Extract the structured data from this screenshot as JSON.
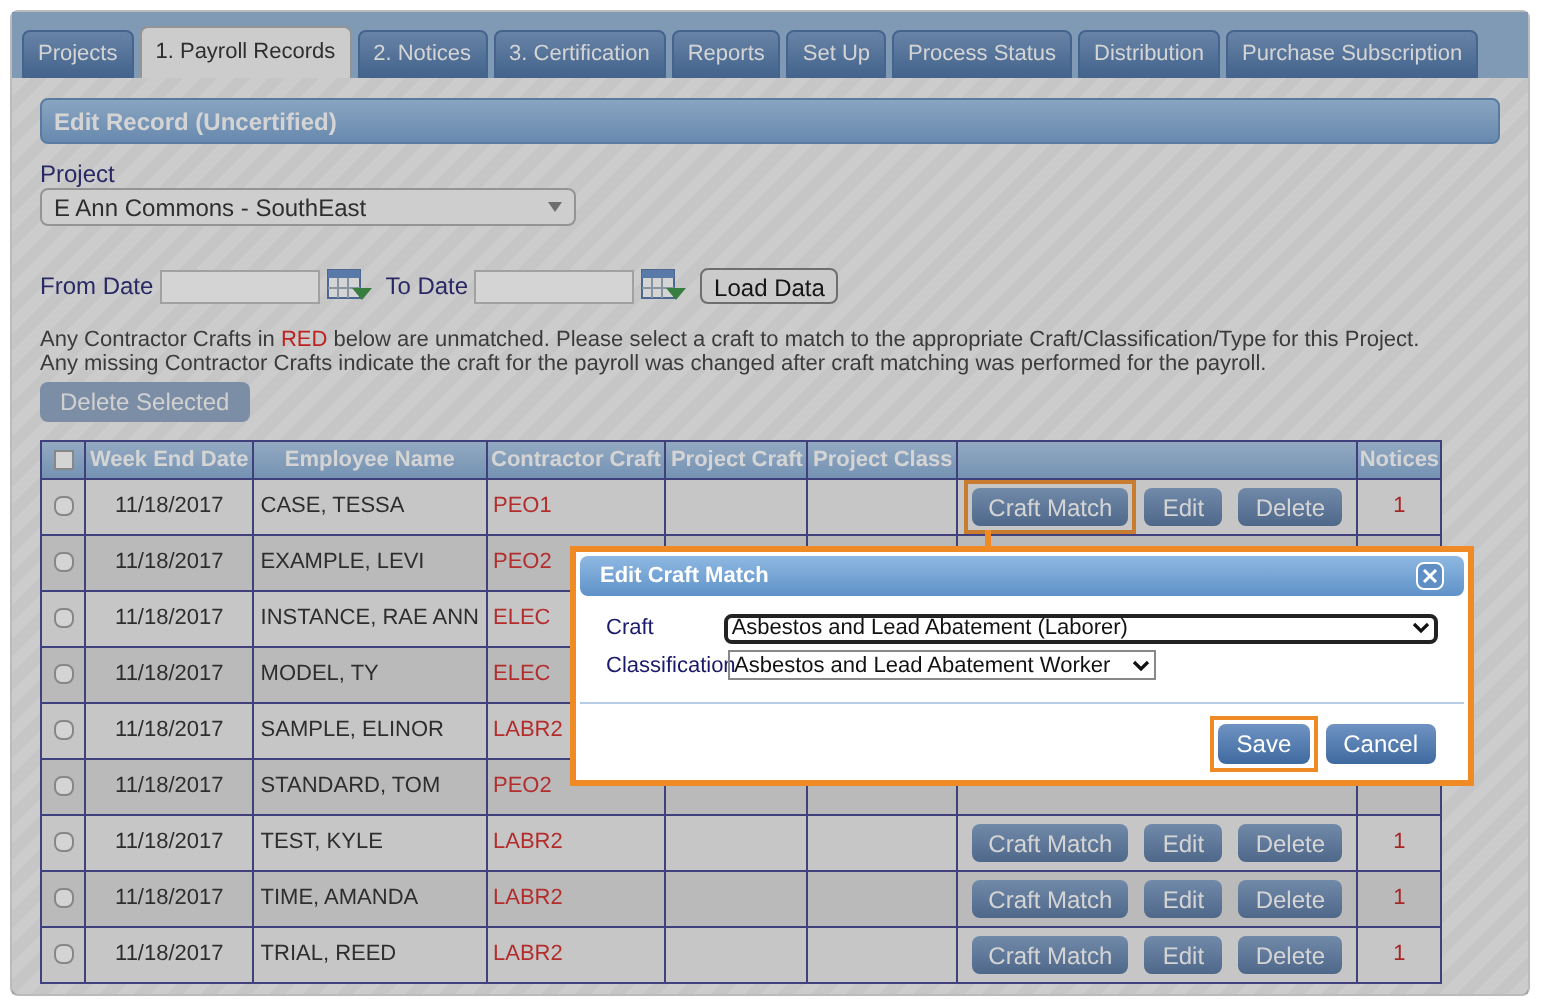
{
  "tabs": [
    {
      "label": "Projects",
      "selected": false
    },
    {
      "label": "1. Payroll Records",
      "selected": true
    },
    {
      "label": "2. Notices",
      "selected": false
    },
    {
      "label": "3. Certification",
      "selected": false
    },
    {
      "label": "Reports",
      "selected": false
    },
    {
      "label": "Set Up",
      "selected": false
    },
    {
      "label": "Process Status",
      "selected": false
    },
    {
      "label": "Distribution",
      "selected": false
    },
    {
      "label": "Purchase Subscription",
      "selected": false
    }
  ],
  "section_title": "Edit Record (Uncertified)",
  "project": {
    "label": "Project",
    "value": "E Ann Commons - SouthEast"
  },
  "from_date": {
    "label": "From Date"
  },
  "to_date": {
    "label": "To Date"
  },
  "load_button": "Load Data",
  "notes": [
    {
      "before": "Any Contractor Crafts in ",
      "highlight": "RED",
      "after": " below are unmatched. Please select a craft to match to the appropriate Craft/Classification/Type for this Project."
    },
    {
      "before": "Any missing Contractor Crafts indicate the craft for the payroll was changed after craft matching was performed for the payroll."
    }
  ],
  "delete_button": {
    "label": "Delete Selected",
    "disabled": true
  },
  "table": {
    "select_all": {
      "checked": false
    },
    "columns": [
      "Week End Date",
      "Employee Name",
      "Contractor Craft",
      "Project Craft",
      "Project Class",
      "Notices"
    ],
    "rows": [
      {
        "selected": false,
        "date": "11/18/2017",
        "employee": "CASE, TESSA",
        "craft": "PEO1",
        "unmatched": true,
        "actions": [
          {
            "label": "Craft Match",
            "highlighted": true
          },
          {
            "label": "Edit",
            "highlighted": false
          },
          {
            "label": "Delete",
            "highlighted": false
          }
        ],
        "notices": "1"
      },
      {
        "selected": false,
        "date": "11/18/2017",
        "employee": "EXAMPLE, LEVI",
        "craft": "PEO2",
        "unmatched": true
      },
      {
        "selected": false,
        "date": "11/18/2017",
        "employee": "INSTANCE, RAE ANN",
        "craft": "ELEC",
        "unmatched": true
      },
      {
        "selected": false,
        "date": "11/18/2017",
        "employee": "MODEL, TY",
        "craft": "ELEC",
        "unmatched": true
      },
      {
        "selected": false,
        "date": "11/18/2017",
        "employee": "SAMPLE, ELINOR",
        "craft": "LABR2",
        "unmatched": true
      },
      {
        "selected": false,
        "date": "11/18/2017",
        "employee": "STANDARD, TOM",
        "craft": "PEO2",
        "unmatched": true
      },
      {
        "selected": false,
        "date": "11/18/2017",
        "employee": "TEST, KYLE",
        "craft": "LABR2",
        "unmatched": true,
        "actions": [
          {
            "label": "Craft Match",
            "highlighted": false
          },
          {
            "label": "Edit",
            "highlighted": false
          },
          {
            "label": "Delete",
            "highlighted": false
          }
        ],
        "notices": "1"
      },
      {
        "selected": false,
        "date": "11/18/2017",
        "employee": "TIME, AMANDA",
        "craft": "LABR2",
        "unmatched": true,
        "actions": [
          {
            "label": "Craft Match",
            "highlighted": false
          },
          {
            "label": "Edit",
            "highlighted": false
          },
          {
            "label": "Delete",
            "highlighted": false
          }
        ],
        "notices": "1"
      },
      {
        "selected": false,
        "date": "11/18/2017",
        "employee": "TRIAL, REED",
        "craft": "LABR2",
        "unmatched": true,
        "actions": [
          {
            "label": "Craft Match",
            "highlighted": false
          },
          {
            "label": "Edit",
            "highlighted": false
          },
          {
            "label": "Delete",
            "highlighted": false
          }
        ],
        "notices": "1"
      }
    ]
  },
  "dialog": {
    "title": "Edit Craft Match",
    "fields": [
      {
        "label": "Craft",
        "value": "Asbestos and Lead Abatement (Laborer)"
      },
      {
        "label": "Classification",
        "value": "Asbestos and Lead Abatement Worker"
      }
    ],
    "buttons": [
      {
        "label": "Save",
        "highlighted": true
      },
      {
        "label": "Cancel",
        "highlighted": false
      }
    ]
  }
}
